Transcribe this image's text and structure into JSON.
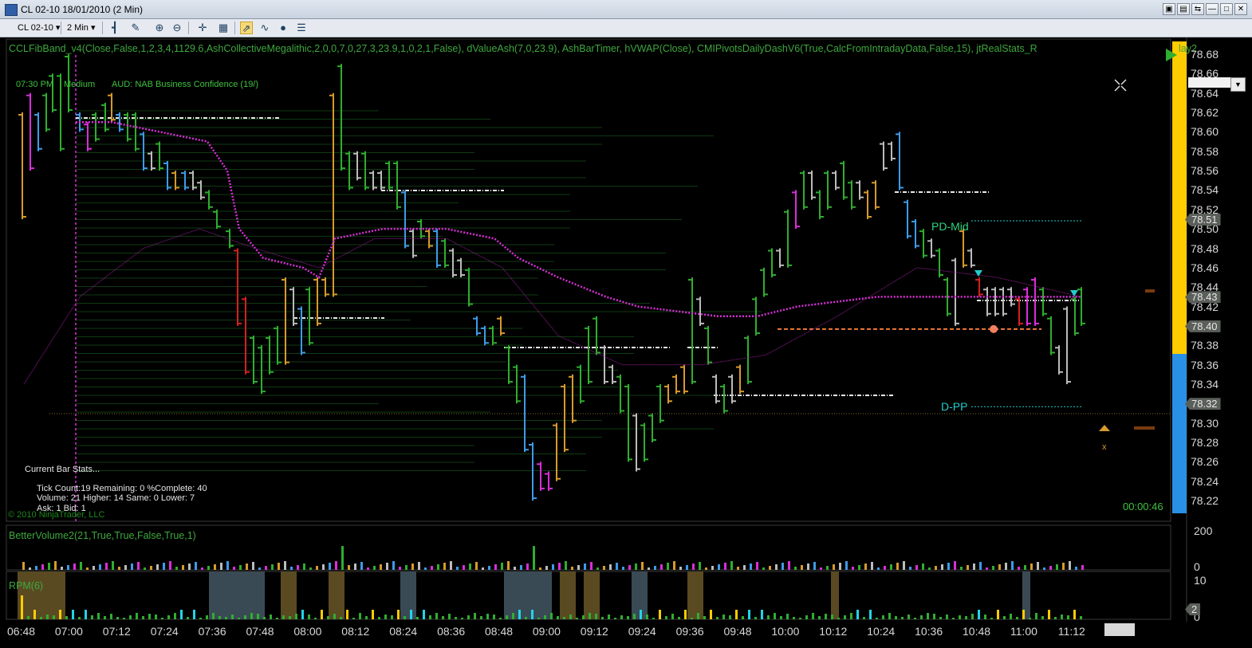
{
  "window": {
    "title": "CL 02-10  18/01/2010 (2 Min)",
    "buttons": [
      "▣",
      "▤",
      "⇆",
      "—",
      "□",
      "✕"
    ]
  },
  "toolbar": {
    "instrument": "CL 02-10",
    "interval": "2 Min"
  },
  "price_indicators_label": "CCLFibBand_v4(Close,False,1,2,3,4,1129.6,AshCollectiveMegalithic,2,0,0,7,0,27,3,23.9,1,0,2,1,False), dValueAsh(7,0,23.9), AshBarTimer, hVWAP(Close), CMIPivotsDailyDashV6(True,CalcFromIntradayData,False,15), jtRealStats_R",
  "price_indicators_label_tail": "lay2",
  "news": {
    "time": "07:30 PM",
    "impact": "Medium",
    "event": "AUD: NAB Business Confidence (19/)"
  },
  "stats": {
    "header": "Current Bar Stats...",
    "line1": "Tick Count:19  Remaining: 0  %Complete: 40",
    "line2": "Volume: 21   Higher: 14   Same: 0   Lower: 7",
    "line3": "Ask: 1  Bid: 1"
  },
  "copyright": "© 2010 NinjaTrader, LLC",
  "bar_timer": "00:00:46",
  "pivot_labels": {
    "pd_mid": "PD-Mid",
    "d_pp": "D-PP"
  },
  "price_axis": {
    "ticks": [
      "78.68",
      "78.66",
      "78.64",
      "78.62",
      "78.60",
      "78.58",
      "78.56",
      "78.54",
      "78.52",
      "78.50",
      "78.48",
      "78.46",
      "78.44",
      "78.42",
      "78.40",
      "78.38",
      "78.36",
      "78.34",
      "78.32",
      "78.30",
      "78.28",
      "78.26",
      "78.24",
      "78.22"
    ],
    "tags": [
      {
        "value": "78.51",
        "price": 78.51
      },
      {
        "value": "78.43",
        "price": 78.43
      },
      {
        "value": "78.40",
        "price": 78.4
      },
      {
        "value": "78.32",
        "price": 78.32
      }
    ]
  },
  "volume_panel": {
    "label": "BetterVolume2(21,True,True,False,True,1)",
    "ticks": [
      "200",
      "0"
    ]
  },
  "rpm_panel": {
    "label": "RPM(6)",
    "ticks": [
      "10",
      "0"
    ],
    "value_tag": "2"
  },
  "time_axis": [
    "06:48",
    "07:00",
    "07:12",
    "07:24",
    "07:36",
    "07:48",
    "08:00",
    "08:12",
    "08:24",
    "08:36",
    "08:48",
    "09:00",
    "09:12",
    "09:24",
    "09:36",
    "09:48",
    "10:00",
    "10:12",
    "10:24",
    "10:36",
    "10:48",
    "11:00",
    "11:12"
  ],
  "colors": {
    "up_bar": "#2fae2f",
    "down_bar": "#3d9be9",
    "neutral_bar": "#d79a2c",
    "vwap": "#d92ed9",
    "pivot": "#22cccc",
    "timer_gauge_up": "#ffcc00",
    "timer_gauge_down": "#2a90e6"
  },
  "icons": [
    "chart-bars-icon",
    "pencil-icon",
    "zoom-in-icon",
    "zoom-out-icon",
    "crosshair-icon",
    "properties-icon",
    "strategy-icon",
    "indicator-icon",
    "globe-icon",
    "data-box-icon"
  ]
}
